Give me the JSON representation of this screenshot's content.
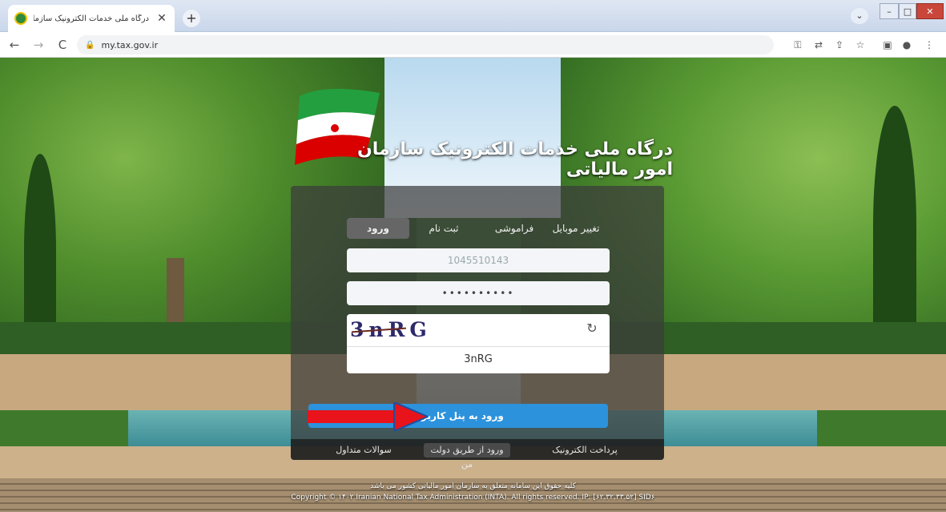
{
  "browser": {
    "tab_title": "درگاه ملی خدمات الکترونیک سازمان امور ...",
    "tab_close": "✕",
    "new_tab": "+",
    "url": "my.tax.gov.ir",
    "nav": {
      "back": "←",
      "forward": "→",
      "reload": "C"
    },
    "window_controls": {
      "search": "⌄",
      "minimize": "–",
      "maximize": "□",
      "close": "✕"
    },
    "toolbar_icons": [
      "key-icon",
      "translate-icon",
      "share-icon",
      "star-icon",
      "sidebar-icon",
      "profile-icon",
      "menu-icon"
    ]
  },
  "portal": {
    "title": "درگاه ملی خدمات الکترونیک سازمان امور مالیاتی"
  },
  "login_panel": {
    "tabs": [
      {
        "label": "تغییر موبایل"
      },
      {
        "label": "فراموشی"
      },
      {
        "label": "ثبت نام"
      },
      {
        "label": "ورود",
        "active": true
      }
    ],
    "username_value": "1045510143",
    "password_value": "••••••••••",
    "captcha_image_text": "3nRG",
    "captcha_input_value": "3nRG",
    "refresh_icon": "↻",
    "submit_label": "ورود به پنل کاربری",
    "footer_links": [
      {
        "label": "پرداخت الکترونیک"
      },
      {
        "label": "ورود از طریق دولت من"
      },
      {
        "label": "سوالات متداول"
      }
    ]
  },
  "copyright": {
    "fa": "کلیه حقوق این سامانه متعلق به سازمان امور مالیاتی کشور می باشد",
    "en": "Copyright © ۱۴۰۲ Iranian National Tax Administration (INTA). All rights reserved. IP: [۶۲.۳۲.۳۳.۵۲] SID۶"
  },
  "colors": {
    "accent": "#2c92dc",
    "arrow": "#e8131b"
  }
}
